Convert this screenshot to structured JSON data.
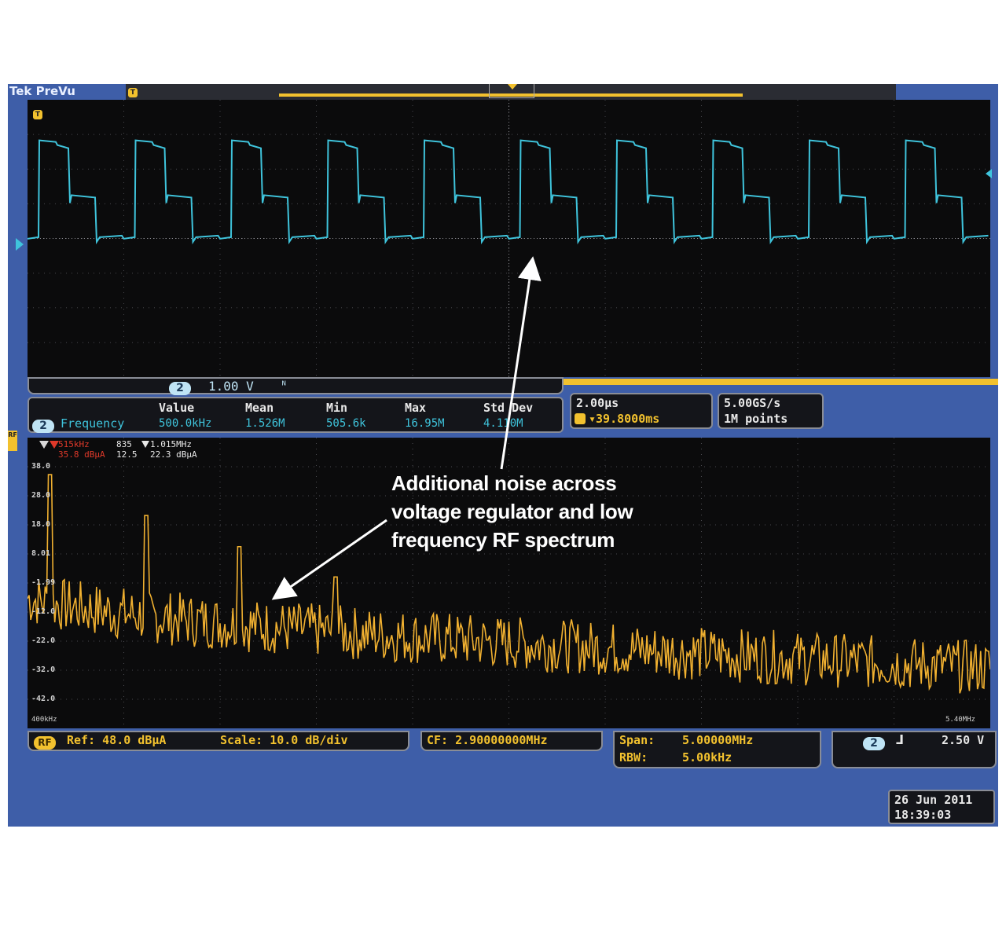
{
  "brand": "Tek PreVu",
  "colors": {
    "ch2": "#3fc4dc",
    "rf": "#f0b030",
    "bg": "#3e5ea8"
  },
  "ch2": {
    "badge": "2",
    "scale": "1.00 V",
    "coupling_icon": "bandwidth-icon"
  },
  "measurement": {
    "headers": [
      "Value",
      "Mean",
      "Min",
      "Max",
      "Std Dev"
    ],
    "label": "Frequency",
    "values": [
      "500.0kHz",
      "1.526M",
      "505.6k",
      "16.95M",
      "4.110M"
    ]
  },
  "horizontal": {
    "scale": "2.00µs",
    "position": "▾39.8000ms"
  },
  "acquisition": {
    "rate": "5.00GS/s",
    "record": "1M points"
  },
  "markers": {
    "m1_freq": "515kHz",
    "m1_amp": "35.8 dBµA",
    "m2_val": "835",
    "m2_sub": "12.5",
    "m3_freq": "1.015MHz",
    "m3_amp": "22.3 dBµA"
  },
  "rf_axis": {
    "y_ticks": [
      "38.0",
      "28.0",
      "18.0",
      "8.01",
      "-1.99",
      "-12.0",
      "-22.0",
      "-32.0",
      "-42.0"
    ],
    "x_start": "400kHz",
    "x_stop": "5.40MHz"
  },
  "annotation": [
    "Additional noise across",
    "voltage regulator and low",
    "frequency RF spectrum"
  ],
  "rf": {
    "badge": "RF",
    "ref": "Ref: 48.0 dBµA",
    "scale": "Scale: 10.0 dB/div",
    "cf": "CF:  2.90000000MHz",
    "span_label": "Span:",
    "span": "5.00000MHz",
    "rbw_label": "RBW:",
    "rbw": "5.00kHz"
  },
  "trigger": {
    "source": "2",
    "level": "2.50 V"
  },
  "datetime": {
    "date": "26 Jun 2011",
    "time": "18:39:03"
  },
  "chart_data": [
    {
      "type": "line",
      "title": "",
      "xlabel": "",
      "ylabel": "",
      "description_values": "Ch2 time-domain switching waveform, 10 cycles across 20 µs at 500 kHz",
      "series": [
        {
          "name": "",
          "x_period_us": 2.0,
          "levels_div": {
            "high": 3.1,
            "step": 1.4,
            "low": 0.1
          }
        }
      ],
      "xlim": [
        0,
        20
      ],
      "ylim": [
        -4,
        4
      ]
    },
    {
      "type": "line",
      "title": "",
      "xlabel": "",
      "ylabel": "",
      "x_range_MHz": [
        0.4,
        5.4
      ],
      "ylim": [
        -48,
        48
      ],
      "series": [
        {
          "name": "",
          "peaks": [
            {
              "x": 0.515,
              "y": 35.8
            },
            {
              "x": 1.015,
              "y": 22.3
            },
            {
              "x": 1.5,
              "y": 12
            },
            {
              "x": 2.0,
              "y": 2
            }
          ]
        }
      ]
    }
  ]
}
